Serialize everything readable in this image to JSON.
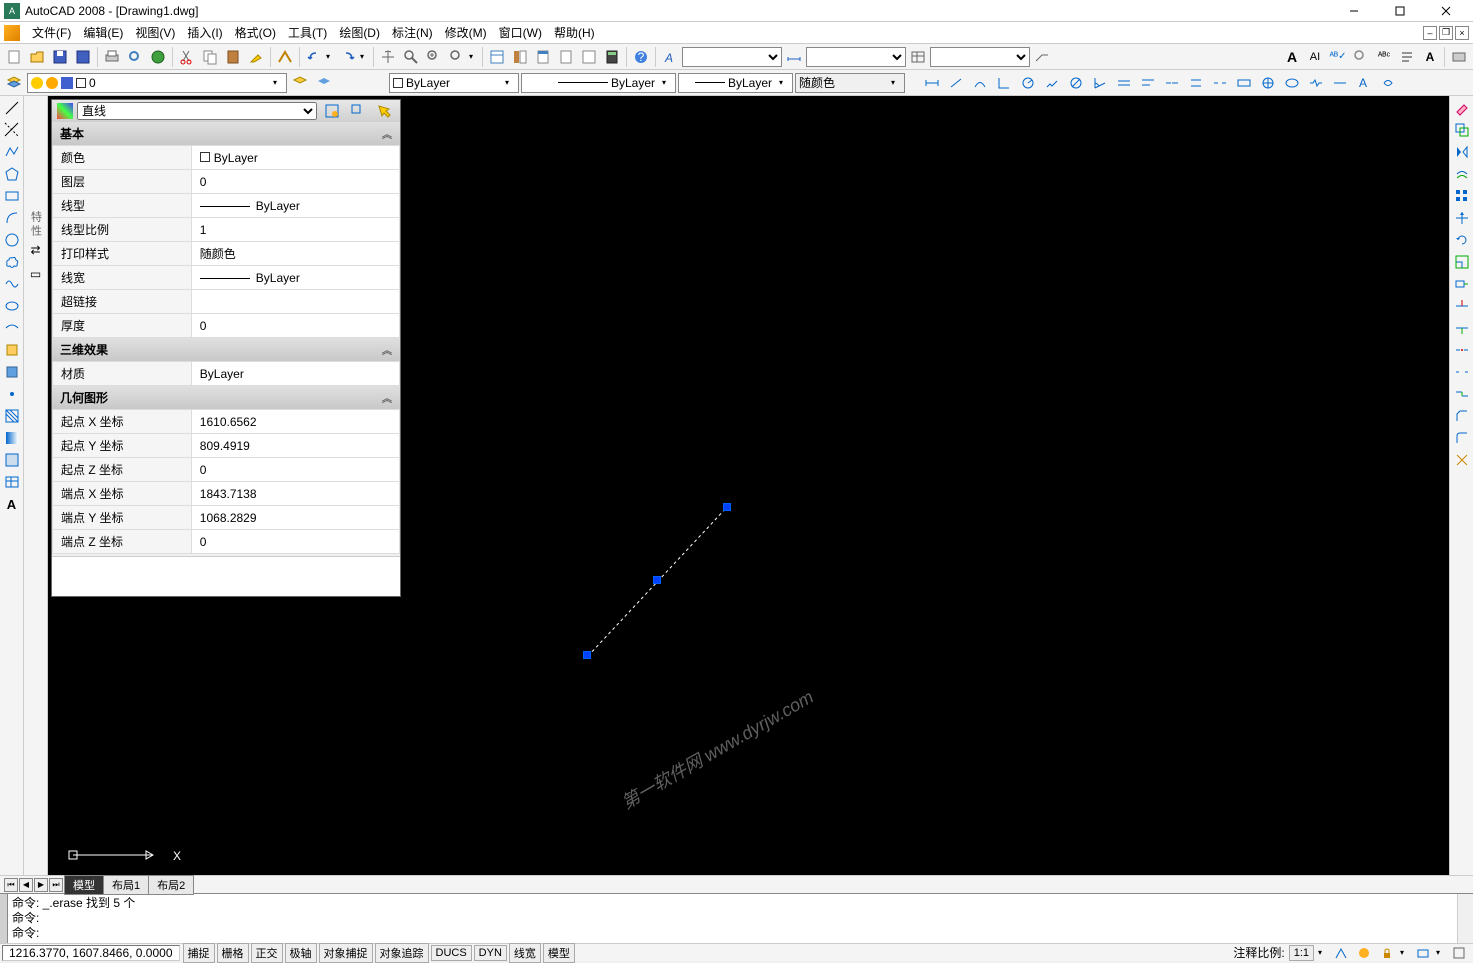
{
  "title": "AutoCAD 2008 - [Drawing1.dwg]",
  "menu": {
    "file": "文件(F)",
    "edit": "编辑(E)",
    "view": "视图(V)",
    "insert": "插入(I)",
    "format": "格式(O)",
    "tools": "工具(T)",
    "draw": "绘图(D)",
    "dim": "标注(N)",
    "modify": "修改(M)",
    "window": "窗口(W)",
    "help": "帮助(H)"
  },
  "layer_bar": {
    "layer_name": "0",
    "color_combo": "ByLayer",
    "linetype_combo": "ByLayer",
    "lineweight_combo": "ByLayer",
    "plotstyle": "随颜色"
  },
  "properties": {
    "type": "直线",
    "basic_header": "基本",
    "rows_basic": [
      {
        "k": "颜色",
        "v": "ByLayer",
        "swatch": true
      },
      {
        "k": "图层",
        "v": "0"
      },
      {
        "k": "线型",
        "v": "ByLayer",
        "line": true
      },
      {
        "k": "线型比例",
        "v": "1"
      },
      {
        "k": "打印样式",
        "v": "随颜色"
      },
      {
        "k": "线宽",
        "v": "ByLayer",
        "line": true
      },
      {
        "k": "超链接",
        "v": ""
      },
      {
        "k": "厚度",
        "v": "0"
      }
    ],
    "three_d_header": "三维效果",
    "rows_3d": [
      {
        "k": "材质",
        "v": "ByLayer"
      }
    ],
    "geom_header": "几何图形",
    "rows_geom": [
      {
        "k": "起点 X 坐标",
        "v": "1610.6562"
      },
      {
        "k": "起点 Y 坐标",
        "v": "809.4919"
      },
      {
        "k": "起点 Z 坐标",
        "v": "0"
      },
      {
        "k": "端点 X 坐标",
        "v": "1843.7138"
      },
      {
        "k": "端点 Y 坐标",
        "v": "1068.2829"
      },
      {
        "k": "端点 Z 坐标",
        "v": "0"
      }
    ]
  },
  "tabs": {
    "model": "模型",
    "layout1": "布局1",
    "layout2": "布局2"
  },
  "cmd": {
    "l1": "命令: _.erase 找到 5 个",
    "l2": "命令:",
    "l3": "命令:"
  },
  "status": {
    "coords": "1216.3770, 1607.8466, 0.0000",
    "snap": "捕捉",
    "grid": "栅格",
    "ortho": "正交",
    "polar": "极轴",
    "osnap": "对象捕捉",
    "otrack": "对象追踪",
    "ducs": "DUCS",
    "dyn": "DYN",
    "lwt": "线宽",
    "model": "模型",
    "anno": "注释比例:",
    "scale": "1:1"
  },
  "watermark": "第一软件网  www.dyrjw.com"
}
